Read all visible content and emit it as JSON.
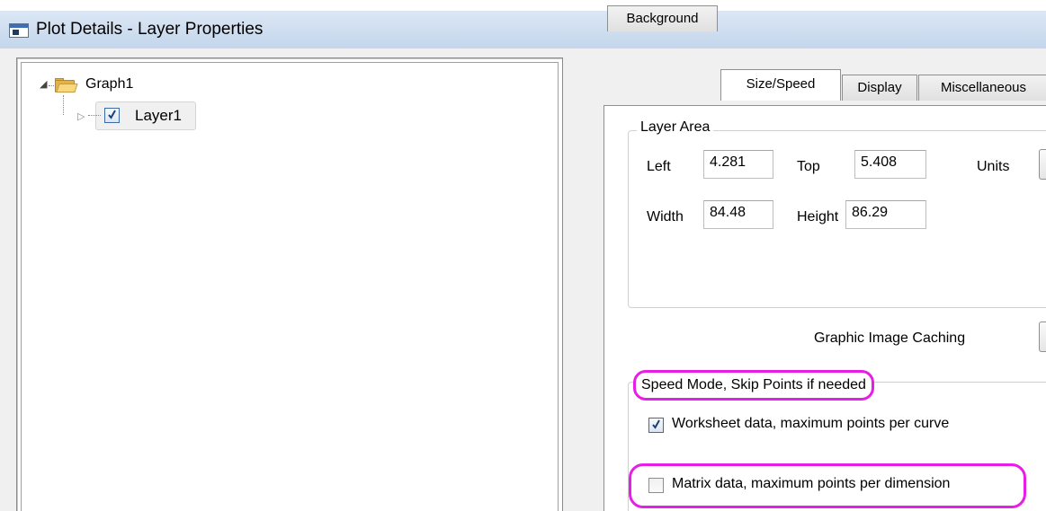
{
  "window": {
    "title": "Plot Details - Layer Properties"
  },
  "tree": {
    "root": {
      "label": "Graph1",
      "expanded": true
    },
    "child": {
      "label": "Layer1",
      "checked": true,
      "expanded": false
    }
  },
  "tabs": [
    {
      "label": "Background",
      "active": false
    },
    {
      "label": "Size/Speed",
      "active": true
    },
    {
      "label": "Display",
      "active": false
    },
    {
      "label": "Miscellaneous",
      "active": false
    }
  ],
  "layer_area": {
    "title": "Layer Area",
    "left_label": "Left",
    "left_value": "4.281",
    "top_label": "Top",
    "top_value": "5.408",
    "units_label": "Units",
    "width_label": "Width",
    "width_value": "84.48",
    "height_label": "Height",
    "height_value": "86.29"
  },
  "caching": {
    "label": "Graphic Image Caching"
  },
  "speed_mode": {
    "title": "Speed Mode, Skip Points if needed",
    "worksheet": {
      "label": "Worksheet data, maximum points per curve",
      "checked": true
    },
    "matrix": {
      "label": "Matrix data, maximum points per dimension",
      "checked": false
    }
  },
  "colors": {
    "highlight": "#e61ee6",
    "accent": "#3e6aa3"
  }
}
